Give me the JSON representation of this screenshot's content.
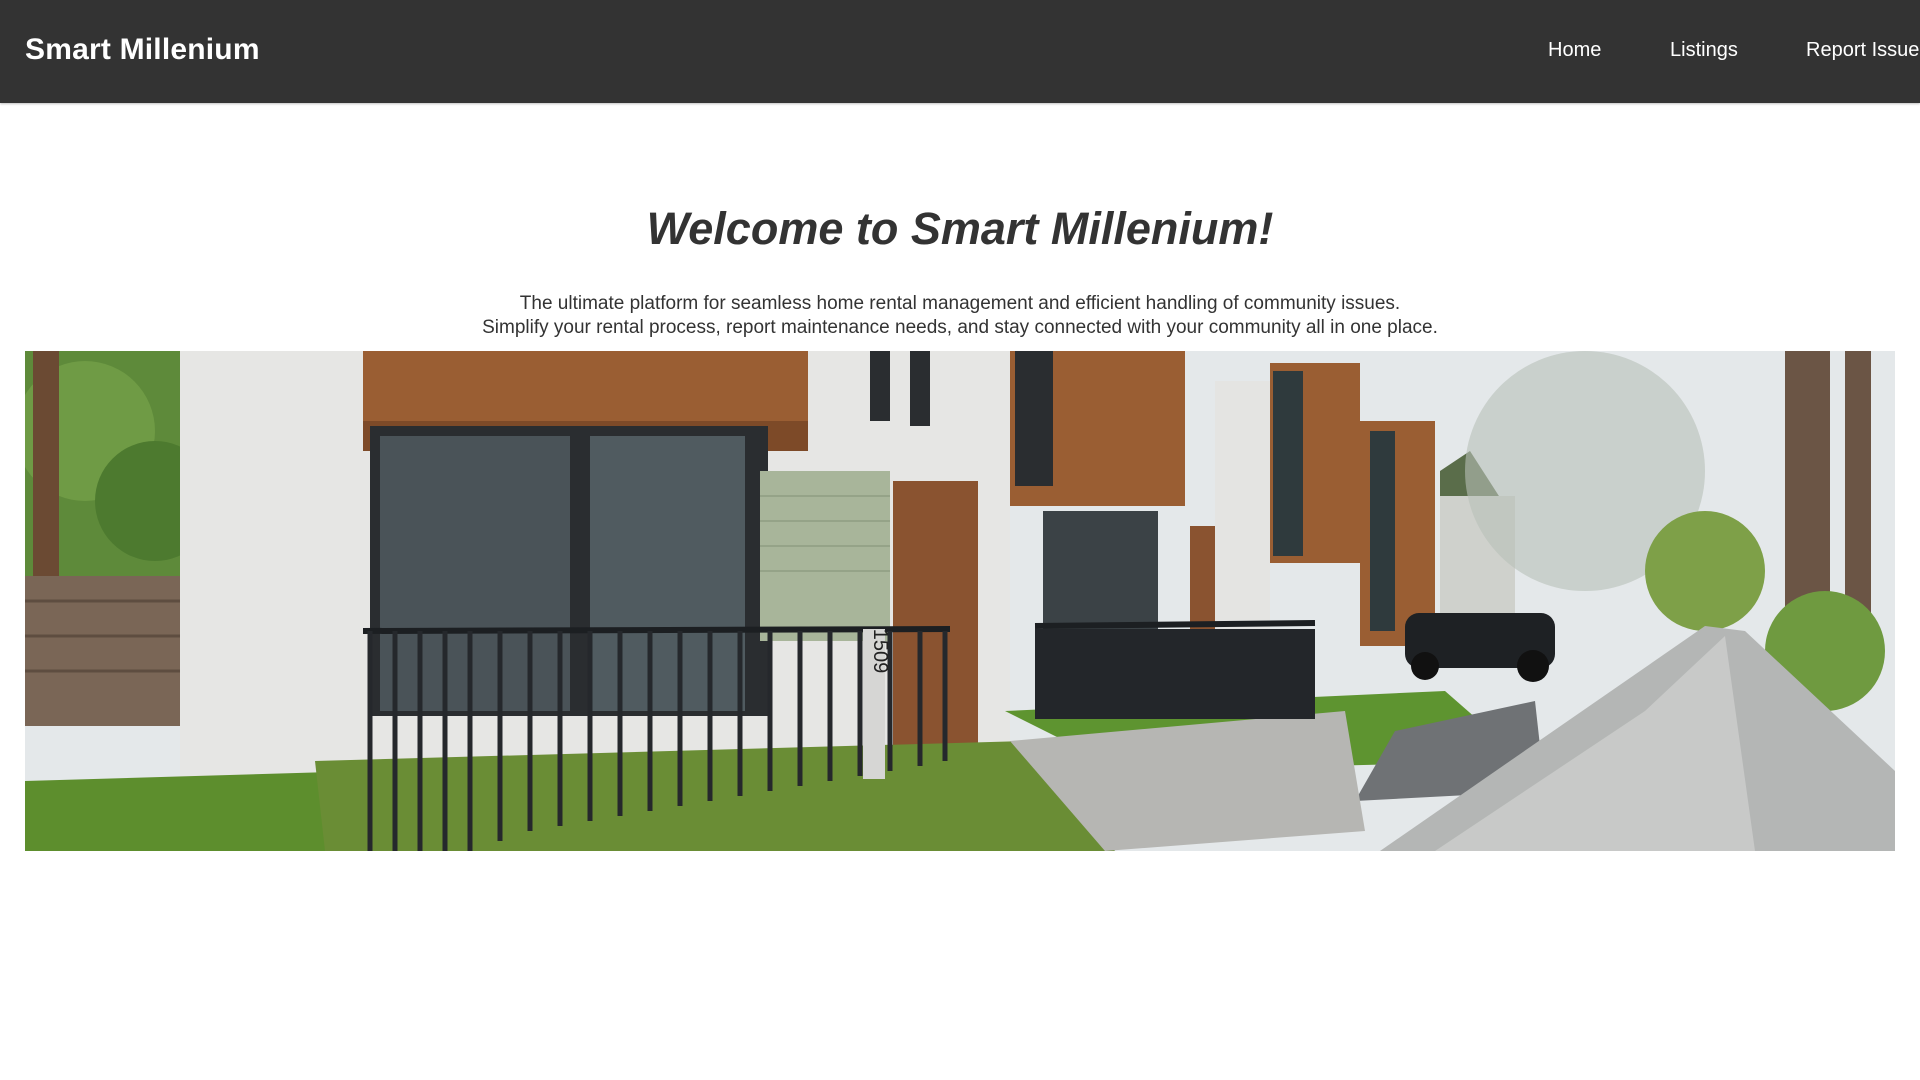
{
  "navbar": {
    "brand": "Smart Millenium",
    "links": [
      {
        "label": "Home"
      },
      {
        "label": "Listings"
      },
      {
        "label": "Report Issue"
      }
    ],
    "background_color": "#333333",
    "text_color": "#ffffff"
  },
  "hero": {
    "title": "Welcome to Smart Millenium!",
    "intro_line_1": "The ultimate platform for seamless home rental management and efficient handling of community issues.",
    "intro_line_2": "Simplify your rental process, report maintenance needs, and stay connected with your community all in one place.",
    "banner_house_number": "1509"
  }
}
